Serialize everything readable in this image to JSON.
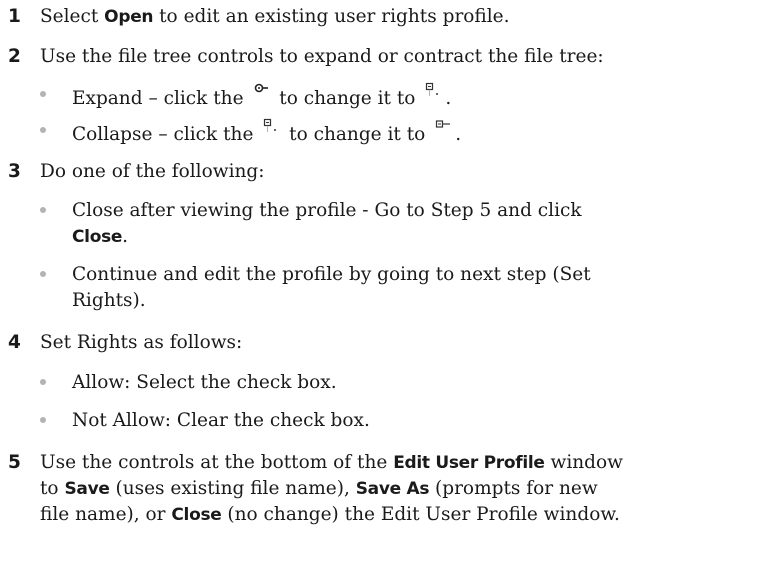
{
  "steps": [
    {
      "number": "1",
      "pre": "Select ",
      "bold1": "Open",
      "post": " to edit an existing user rights profile."
    },
    {
      "number": "2",
      "text": "Use the file tree controls to expand or contract the file tree:",
      "bullets": [
        {
          "pre": "Expand – click the ",
          "mid": " to change it to ",
          "end": ".",
          "icon_from": "expand-node-icon",
          "icon_to": "expanded-node-icon"
        },
        {
          "pre": "Collapse – click the ",
          "mid": " to change it to ",
          "end": ".",
          "icon_from": "expanded-node-icon",
          "icon_to": "collapse-node-icon"
        }
      ]
    },
    {
      "number": "3",
      "text": "Do one of the following:",
      "bullets": [
        {
          "line1": "Close after viewing the profile - Go to Step 5 and click",
          "bold": "Close",
          "end": "."
        },
        {
          "line1": "Continue and edit the profile by going to next step (Set",
          "line2": "Rights)."
        }
      ]
    },
    {
      "number": "4",
      "text": "Set Rights as follows:",
      "bullets": [
        {
          "text": "Allow: Select the check box."
        },
        {
          "text": "Not Allow: Clear the check box."
        }
      ]
    },
    {
      "number": "5",
      "l1_pre": "Use the controls at the bottom of the ",
      "l1_bold": "Edit User Profile",
      "l1_post": " window",
      "l2_pre": "to ",
      "l2_bold1": "Save",
      "l2_mid": " (uses existing file name), ",
      "l2_bold2": "Save As",
      "l2_post": " (prompts for new",
      "l3_pre": "file name), or ",
      "l3_bold": "Close",
      "l3_post": " (no change) the Edit User Profile window."
    }
  ]
}
